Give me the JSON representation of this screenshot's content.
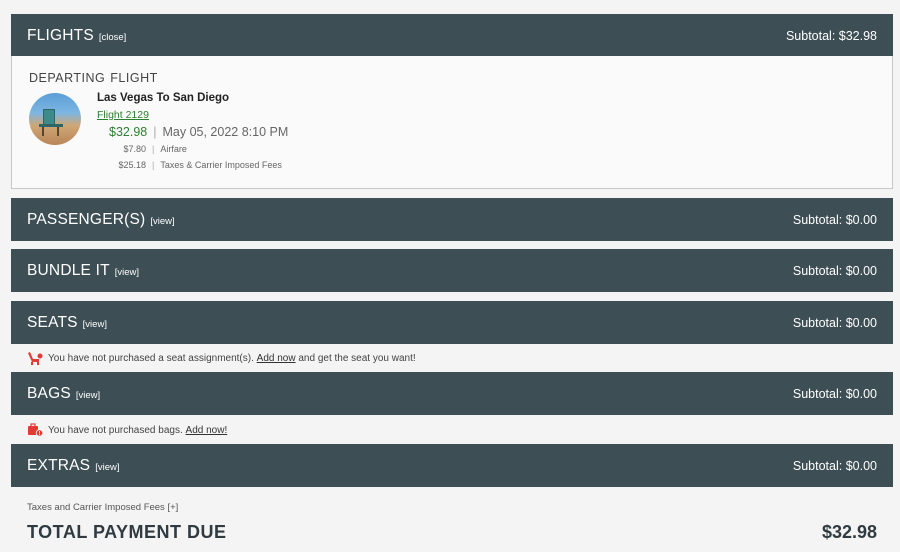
{
  "sections": [
    {
      "title": "FLIGHTS",
      "toggle": "[close]",
      "subtotal": "Subtotal: $32.98"
    },
    {
      "title": "PASSENGER(S)",
      "toggle": "[view]",
      "subtotal": "Subtotal: $0.00"
    },
    {
      "title": "BUNDLE IT",
      "toggle": "[view]",
      "subtotal": "Subtotal: $0.00"
    },
    {
      "title": "SEATS",
      "toggle": "[view]",
      "subtotal": "Subtotal: $0.00"
    },
    {
      "title": "BAGS",
      "toggle": "[view]",
      "subtotal": "Subtotal: $0.00"
    },
    {
      "title": "EXTRAS",
      "toggle": "[view]",
      "subtotal": "Subtotal: $0.00"
    }
  ],
  "flight": {
    "label_1": "DEPARTING",
    "label_2": "FLIGHT",
    "route": "Las Vegas To San Diego",
    "flight_number": "Flight 2129",
    "price": "$32.98",
    "datetime": "May 05, 2022 8:10 PM",
    "fees": [
      {
        "amount": "$7.80",
        "label": "Airfare"
      },
      {
        "amount": "$25.18",
        "label": "Taxes & Carrier Imposed Fees"
      }
    ]
  },
  "seats_notice": {
    "text_before": "You have not purchased a seat assignment(s).",
    "link": "Add now",
    "text_after": "and get the seat you want!"
  },
  "bags_notice": {
    "text_before": "You have not purchased bags.",
    "link": "Add now!"
  },
  "footer": {
    "taxes_link": "Taxes and Carrier Imposed Fees [+]",
    "total_label": "TOTAL PAYMENT DUE",
    "total_value": "$32.98"
  },
  "colors": {
    "bar": "#3d4e55",
    "price_green": "#2e7d32",
    "alert_red": "#e53935"
  }
}
